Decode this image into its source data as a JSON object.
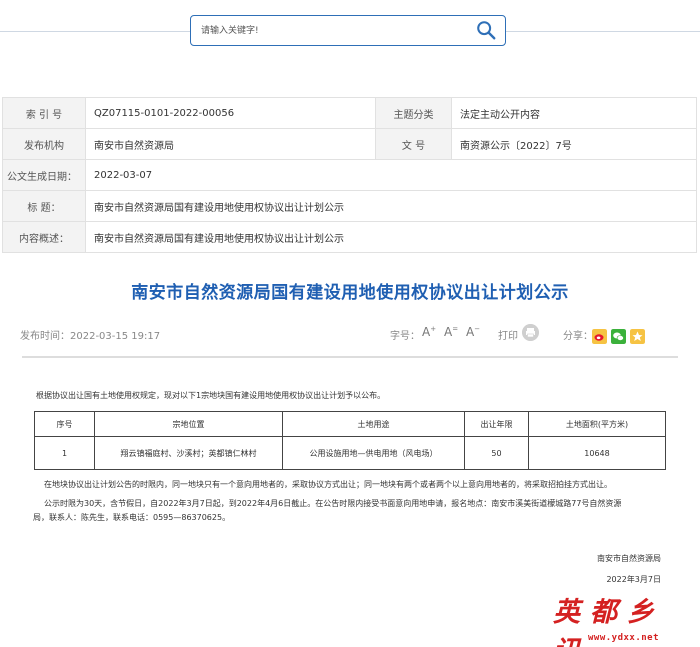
{
  "search": {
    "placeholder": "请输入关键字!",
    "icon": "search-icon"
  },
  "meta": {
    "index_label": "索 引 号",
    "index_value": "QZ07115-0101-2022-00056",
    "topic_label": "主题分类",
    "topic_value": "法定主动公开内容",
    "publisher_label": "发布机构",
    "publisher_value": "南安市自然资源局",
    "docno_label": "文  号",
    "docno_value": "南资源公示〔2022〕7号",
    "date_label": "公文生成日期：",
    "date_value": "2022-03-07",
    "title_label": "标  题：",
    "title_value": "南安市自然资源局国有建设用地使用权协议出让计划公示",
    "summary_label": "内容概述：",
    "summary_value": "南安市自然资源局国有建设用地使用权协议出让计划公示"
  },
  "article": {
    "title": "南安市自然资源局国有建设用地使用权协议出让计划公示",
    "publish_time": "发布时间：2022-03-15 19:17",
    "font_size_label": "字号：",
    "font_sizes": [
      "A",
      "A",
      "A"
    ],
    "print_label": "打印",
    "share_label": "分享：",
    "intro": "根据协议出让国有土地使用权规定，现对以下1宗地块国有建设用地使用权协议出让计划予以公布。",
    "table": {
      "headers": [
        "序号",
        "宗地位置",
        "土地用途",
        "出让年限",
        "土地面积(平方米)"
      ],
      "rows": [
        [
          "1",
          "翔云镇福庭村、沙溪村；英都镇仁林村",
          "公用设施用地—供电用地（风电场）",
          "50",
          "10648"
        ]
      ]
    },
    "para1": "在地块协议出让计划公告的时限内，同一地块只有一个意向用地者的，采取协议方式出让；同一地块有两个或者两个以上意向用地者的，将采取招拍挂方式出让。",
    "para2_line1": "公示时限为30天，含节假日，自2022年3月7日起，到2022年4月6日截止。在公告时限内接受书面意向用地申请，报名地点：南安市溪美街道檬城路77号自然资源",
    "para2_line2": "局，联系人：陈先生，联系电话：0595—86370625。",
    "sign_org": "南安市自然资源局",
    "sign_date": "2022年3月7日"
  },
  "watermark": {
    "text": "英都乡讯",
    "url": "www.ydxx.net"
  },
  "colors": {
    "accent": "#1f5fb2",
    "search_border": "#2e6fb7",
    "watermark": "#d42121",
    "label_bg": "#f3f3f3"
  }
}
